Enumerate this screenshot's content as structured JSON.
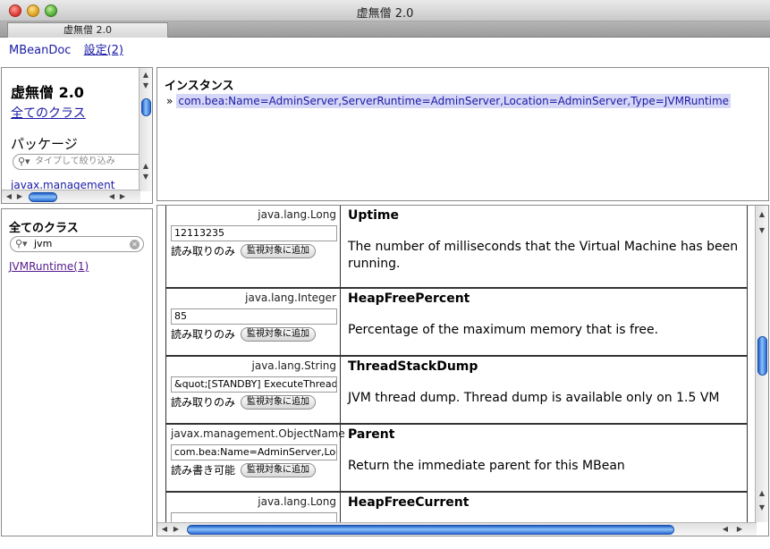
{
  "window": {
    "title": "虚無僧 2.0"
  },
  "tab": {
    "label": "虚無僧 2.0"
  },
  "nav": {
    "mbeandoc": "MBeanDoc",
    "settings": "設定(2)"
  },
  "package_frame": {
    "title": "虚無僧 2.0",
    "all_classes_link": "全てのクラス",
    "packages_label": "パッケージ",
    "filter_placeholder": "タイプして絞り込み",
    "packages": [
      "javax.management"
    ]
  },
  "class_frame": {
    "title": "全てのクラス",
    "search_value": "jvm",
    "classes": [
      "JVMRuntime(1)"
    ]
  },
  "instance_frame": {
    "title": "インスタンス",
    "instance": "com.bea:Name=AdminServer,ServerRuntime=AdminServer,Location=AdminServer,Type=JVMRuntime"
  },
  "attributes": [
    {
      "type": "java.lang.Long",
      "value": "12113235",
      "access": "読み取りのみ",
      "button": "監視対象に追加",
      "name": "Uptime",
      "description": "The number of milliseconds that the Virtual Machine has been running."
    },
    {
      "type": "java.lang.Integer",
      "value": "85",
      "access": "読み取りのみ",
      "button": "監視対象に追加",
      "name": "HeapFreePercent",
      "description": "Percentage of the maximum memory that is free."
    },
    {
      "type": "java.lang.String",
      "value": "&quot;[STANDBY] ExecuteThread:",
      "access": "読み取りのみ",
      "button": "監視対象に追加",
      "name": "ThreadStackDump",
      "description": "JVM thread dump. Thread dump is available only on 1.5 VM"
    },
    {
      "type": "javax.management.ObjectName",
      "value": "com.bea:Name=AdminServer,Loca",
      "access": "読み書き可能",
      "button": "監視対象に追加",
      "name": "Parent",
      "description": "Return the immediate parent for this MBean"
    },
    {
      "type": "java.lang.Long",
      "value": "",
      "access": "",
      "button": "",
      "name": "HeapFreeCurrent",
      "description": ""
    }
  ],
  "icons": {
    "close": "close-button",
    "minimize": "minimize-button",
    "maximize": "zoom-button",
    "search": "magnifier-icon",
    "clear": "clear-search-icon"
  },
  "colors": {
    "link": "#1a1aa6",
    "visited": "#551a8b",
    "scroll_thumb": "#2b6ad6",
    "highlight": "#d6d6f7"
  }
}
